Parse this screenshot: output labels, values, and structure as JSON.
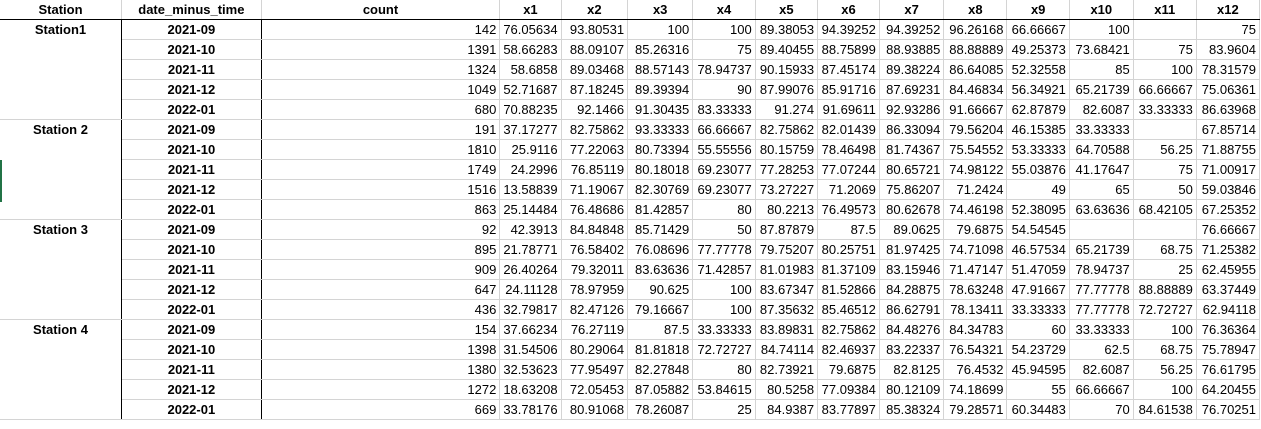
{
  "columns": [
    "Station",
    "date_minus_time",
    "count",
    "x1",
    "x2",
    "x3",
    "x4",
    "x5",
    "x6",
    "x7",
    "x8",
    "x9",
    "x10",
    "x11",
    "x12"
  ],
  "groups": [
    {
      "station": "Station1",
      "rows": [
        [
          "2021-09",
          "142",
          "76.05634",
          "93.80531",
          "100",
          "100",
          "89.38053",
          "94.39252",
          "94.39252",
          "96.26168",
          "66.66667",
          "100",
          "",
          "75"
        ],
        [
          "2021-10",
          "1391",
          "58.66283",
          "88.09107",
          "85.26316",
          "75",
          "89.40455",
          "88.75899",
          "88.93885",
          "88.88889",
          "49.25373",
          "73.68421",
          "75",
          "83.9604"
        ],
        [
          "2021-11",
          "1324",
          "58.6858",
          "89.03468",
          "88.57143",
          "78.94737",
          "90.15933",
          "87.45174",
          "89.38224",
          "86.64085",
          "52.32558",
          "85",
          "100",
          "78.31579"
        ],
        [
          "2021-12",
          "1049",
          "52.71687",
          "87.18245",
          "89.39394",
          "90",
          "87.99076",
          "85.91716",
          "87.69231",
          "84.46834",
          "56.34921",
          "65.21739",
          "66.66667",
          "75.06361"
        ],
        [
          "2022-01",
          "680",
          "70.88235",
          "92.1466",
          "91.30435",
          "83.33333",
          "91.274",
          "91.69611",
          "92.93286",
          "91.66667",
          "62.87879",
          "82.6087",
          "33.33333",
          "86.63968"
        ]
      ]
    },
    {
      "station": "Station 2",
      "rows": [
        [
          "2021-09",
          "191",
          "37.17277",
          "82.75862",
          "93.33333",
          "66.66667",
          "82.75862",
          "82.01439",
          "86.33094",
          "79.56204",
          "46.15385",
          "33.33333",
          "",
          "67.85714"
        ],
        [
          "2021-10",
          "1810",
          "25.9116",
          "77.22063",
          "80.73394",
          "55.55556",
          "80.15759",
          "78.46498",
          "81.74367",
          "75.54552",
          "53.33333",
          "64.70588",
          "56.25",
          "71.88755"
        ],
        [
          "2021-11",
          "1749",
          "24.2996",
          "76.85119",
          "80.18018",
          "69.23077",
          "77.28253",
          "77.07244",
          "80.65721",
          "74.98122",
          "55.03876",
          "41.17647",
          "75",
          "71.00917"
        ],
        [
          "2021-12",
          "1516",
          "13.58839",
          "71.19067",
          "82.30769",
          "69.23077",
          "73.27227",
          "71.2069",
          "75.86207",
          "71.2424",
          "49",
          "65",
          "50",
          "59.03846"
        ],
        [
          "2022-01",
          "863",
          "25.14484",
          "76.48686",
          "81.42857",
          "80",
          "80.2213",
          "76.49573",
          "80.62678",
          "74.46198",
          "52.38095",
          "63.63636",
          "68.42105",
          "67.25352"
        ]
      ]
    },
    {
      "station": "Station 3",
      "rows": [
        [
          "2021-09",
          "92",
          "42.3913",
          "84.84848",
          "85.71429",
          "50",
          "87.87879",
          "87.5",
          "89.0625",
          "79.6875",
          "54.54545",
          "",
          "",
          "76.66667"
        ],
        [
          "2021-10",
          "895",
          "21.78771",
          "76.58402",
          "76.08696",
          "77.77778",
          "79.75207",
          "80.25751",
          "81.97425",
          "74.71098",
          "46.57534",
          "65.21739",
          "68.75",
          "71.25382"
        ],
        [
          "2021-11",
          "909",
          "26.40264",
          "79.32011",
          "83.63636",
          "71.42857",
          "81.01983",
          "81.37109",
          "83.15946",
          "71.47147",
          "51.47059",
          "78.94737",
          "25",
          "62.45955"
        ],
        [
          "2021-12",
          "647",
          "24.11128",
          "78.97959",
          "90.625",
          "100",
          "83.67347",
          "81.52866",
          "84.28875",
          "78.63248",
          "47.91667",
          "77.77778",
          "88.88889",
          "63.37449"
        ],
        [
          "2022-01",
          "436",
          "32.79817",
          "82.47126",
          "79.16667",
          "100",
          "87.35632",
          "85.46512",
          "86.62791",
          "78.13411",
          "33.33333",
          "77.77778",
          "72.72727",
          "62.94118"
        ]
      ]
    },
    {
      "station": "Station 4",
      "rows": [
        [
          "2021-09",
          "154",
          "37.66234",
          "76.27119",
          "87.5",
          "33.33333",
          "83.89831",
          "82.75862",
          "84.48276",
          "84.34783",
          "60",
          "33.33333",
          "100",
          "76.36364"
        ],
        [
          "2021-10",
          "1398",
          "31.54506",
          "80.29064",
          "81.81818",
          "72.72727",
          "84.74114",
          "82.46937",
          "83.22337",
          "76.54321",
          "54.23729",
          "62.5",
          "68.75",
          "75.78947"
        ],
        [
          "2021-11",
          "1380",
          "32.53623",
          "77.95497",
          "82.27848",
          "80",
          "82.73921",
          "79.6875",
          "82.8125",
          "76.4532",
          "45.94595",
          "82.6087",
          "56.25",
          "76.61795"
        ],
        [
          "2021-12",
          "1272",
          "18.63208",
          "72.05453",
          "87.05882",
          "53.84615",
          "80.5258",
          "77.09384",
          "80.12109",
          "74.18699",
          "55",
          "66.66667",
          "100",
          "64.20455"
        ],
        [
          "2022-01",
          "669",
          "33.78176",
          "80.91068",
          "78.26087",
          "25",
          "84.9387",
          "83.77897",
          "85.38324",
          "79.28571",
          "60.34483",
          "70",
          "84.61538",
          "76.70251"
        ]
      ]
    }
  ],
  "colors": {
    "grid": "#d4d4d4",
    "border": "#000000",
    "selection": "#217346"
  }
}
